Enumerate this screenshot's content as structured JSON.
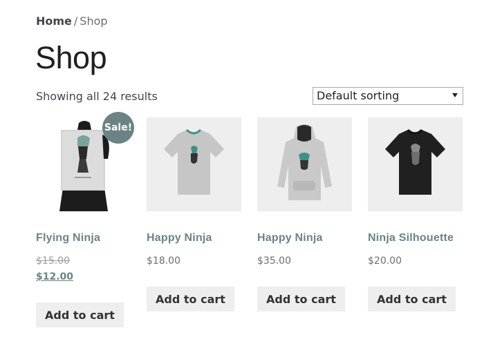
{
  "breadcrumb": {
    "home": "Home",
    "separator": "/",
    "current": "Shop"
  },
  "page_title": "Shop",
  "result_count": "Showing all 24 results",
  "ordering": {
    "selected": "Default sorting"
  },
  "products": [
    {
      "name": "Flying Ninja",
      "old_price": "$15.00",
      "price": "$12.00",
      "sale_badge": "Sale!",
      "button": "Add to cart",
      "image_icon": "poster-icon"
    },
    {
      "name": "Happy Ninja",
      "price": "$18.00",
      "button": "Add to cart",
      "image_icon": "tshirt-icon"
    },
    {
      "name": "Happy Ninja",
      "price": "$35.00",
      "button": "Add to cart",
      "image_icon": "hoodie-icon"
    },
    {
      "name": "Ninja Silhouette",
      "price": "$20.00",
      "button": "Add to cart",
      "image_icon": "tshirt-icon"
    }
  ],
  "colors": {
    "accent": "#6b8384",
    "card_bg": "#eeeeee",
    "text": "#43454b",
    "title": "#1f1f1f",
    "tshirt_light": "#c9c9c9",
    "tshirt_dark": "#222222"
  }
}
